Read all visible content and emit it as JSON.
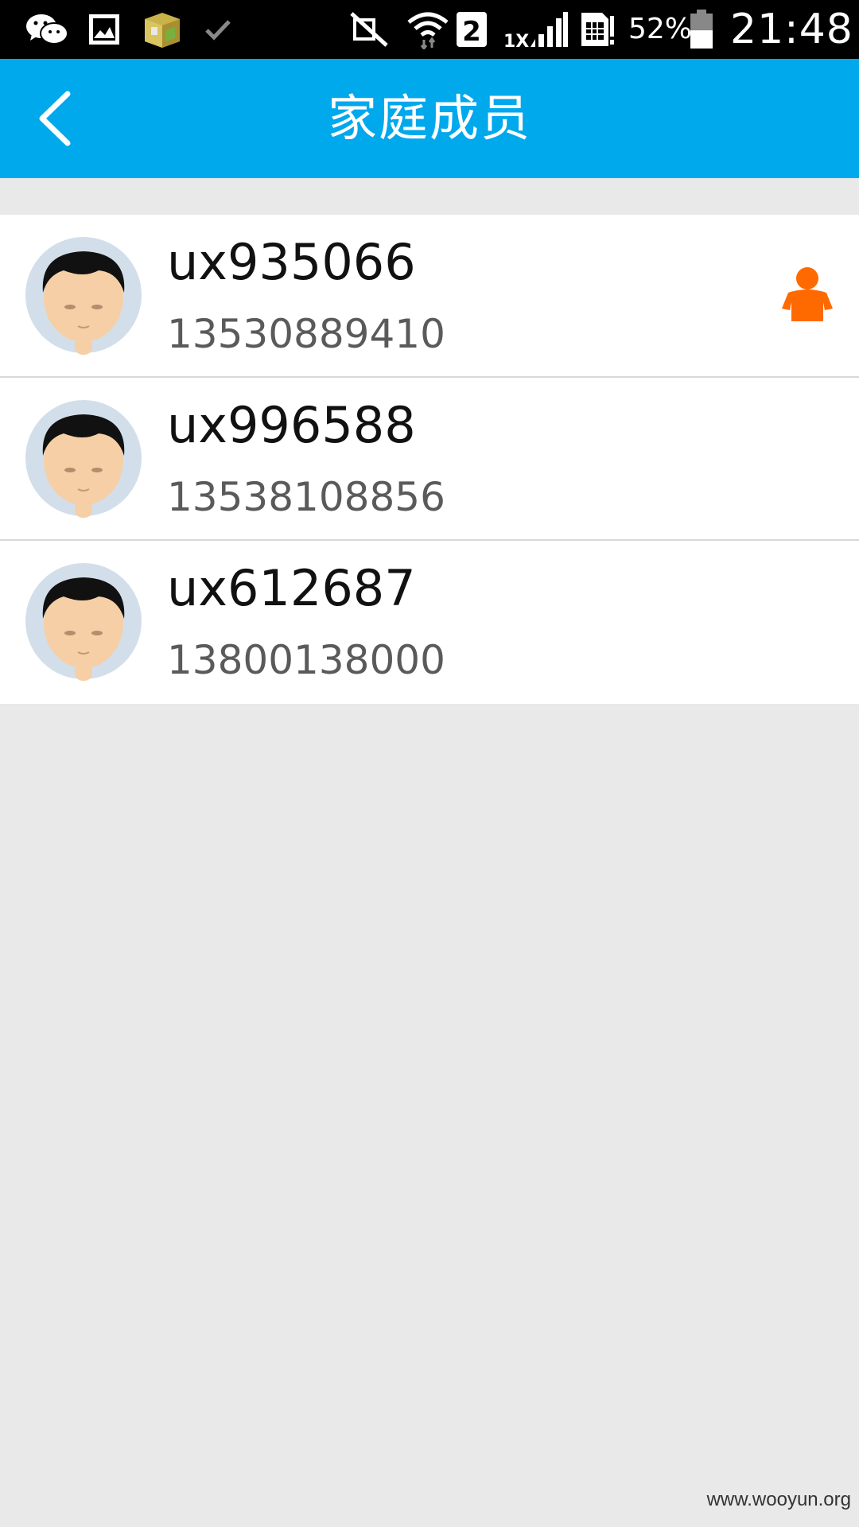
{
  "status_bar": {
    "icons": [
      "wechat-icon",
      "gallery-icon",
      "app-package-icon",
      "check-icon",
      "mute-icon",
      "wifi-icon",
      "sim2-icon",
      "signal-1x-icon",
      "sim-card-icon",
      "battery-icon"
    ],
    "network_label": "1X",
    "sim_label": "2",
    "battery_percent": "52%",
    "battery_level": 0.52,
    "time": "21:48"
  },
  "header": {
    "title": "家庭成员",
    "back_icon": "chevron-left-icon"
  },
  "members": [
    {
      "name": "ux935066",
      "phone": "13530889410",
      "is_admin": true
    },
    {
      "name": "ux996588",
      "phone": "13538108856",
      "is_admin": false
    },
    {
      "name": "ux612687",
      "phone": "13800138000",
      "is_admin": false
    }
  ],
  "colors": {
    "title_bar": "#00a8ec",
    "admin_icon": "#ff6a00",
    "background": "#e9e9e9"
  },
  "watermark": "www.wooyun.org"
}
